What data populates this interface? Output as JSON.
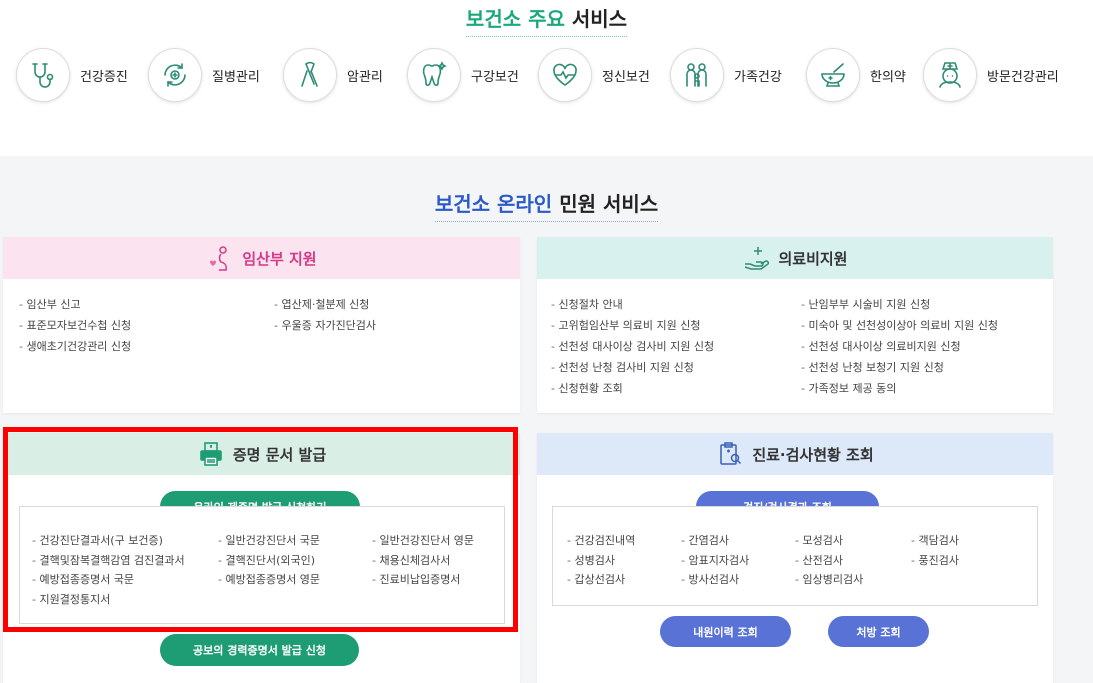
{
  "main_services": {
    "title_accent": "보건소 주요",
    "title_rest": "서비스",
    "items": [
      {
        "label": "건강증진",
        "icon": "stethoscope-icon"
      },
      {
        "label": "질병관리",
        "icon": "disease-cycle-icon"
      },
      {
        "label": "암관리",
        "icon": "ribbon-icon"
      },
      {
        "label": "구강보건",
        "icon": "tooth-icon"
      },
      {
        "label": "정신보건",
        "icon": "heart-pulse-icon"
      },
      {
        "label": "가족건강",
        "icon": "family-icon"
      },
      {
        "label": "한의약",
        "icon": "mortar-pestle-icon"
      },
      {
        "label": "방문건강관리",
        "icon": "nurse-icon"
      }
    ]
  },
  "online_services": {
    "title_accent": "보건소 온라인",
    "title_rest": "민원 서비스",
    "pregnancy": {
      "title": "임산부 지원",
      "items": [
        "임산부 신고",
        "엽산제·철분제 신청",
        "표준모자보건수첩 신청",
        "우울증 자가진단검사",
        "생애초기건강관리 신청"
      ]
    },
    "medical": {
      "title": "의료비지원",
      "items": [
        "신청절차 안내",
        "난임부부 시술비 지원 신청",
        "고위험임산부 의료비 지원 신청",
        "미숙아 및 선천성이상아 의료비 지원 신청",
        "선천성 대사이상 검사비 지원 신청",
        "선천성 대사이상 의료비지원 신청",
        "선천성 난청 검사비 지원 신청",
        "선천성 난청 보청기 지원 신청",
        "신청현황 조회",
        "가족정보 제공 동의"
      ]
    },
    "certificate": {
      "title": "증명 문서 발급",
      "apply_button": "온라인 제증명 발급 신청하기",
      "items": [
        "건강진단결과서(구 보건증)",
        "일반건강진단서 국문",
        "일반건강진단서 영문",
        "결핵및잠복결핵감염 검진결과서",
        "결핵진단서(외국인)",
        "채용신체검사서",
        "예방접종증명서 국문",
        "예방접종증명서 영문",
        "진료비납입증명서",
        "지원결정통지서"
      ],
      "career_button": "공보의 경력증명서 발급 신청"
    },
    "inquiry": {
      "title": "진료·검사현황 조회",
      "results_button": "검진/검사결과 조회",
      "items": [
        "건강검진내역",
        "간염검사",
        "모성검사",
        "객담검사",
        "성병검사",
        "암표지자검사",
        "산전검사",
        "풍진검사",
        "갑상선검사",
        "방사선검사",
        "임상병리검사"
      ],
      "visit_button": "내원이력 조회",
      "prescription_button": "처방 조회"
    }
  }
}
